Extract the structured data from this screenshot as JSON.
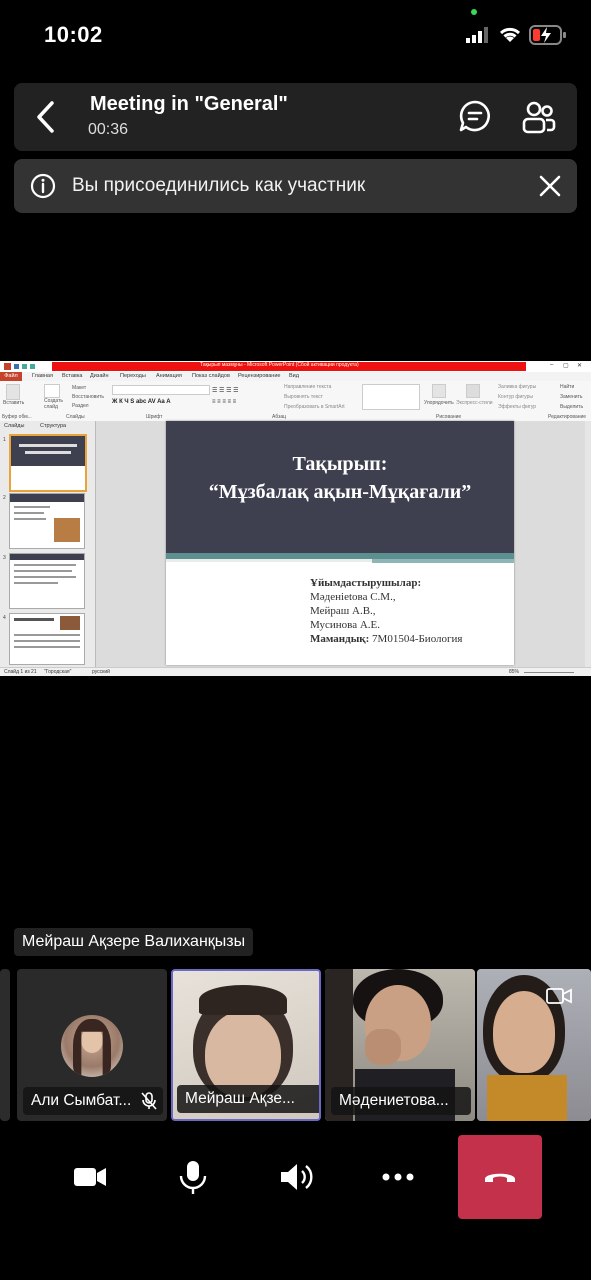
{
  "status_bar": {
    "time": "10:02"
  },
  "meeting": {
    "title": "Meeting in \"General\"",
    "duration": "00:36"
  },
  "banner": {
    "text": "Вы присоединились как участник"
  },
  "shared_screen": {
    "window_title": "Тақырып мазмұны - Microsoft PowerPoint (Сбой активации продукта)",
    "file_tab": "Файл",
    "menu_tabs": [
      "Главная",
      "Вставка",
      "Дизайн",
      "Переходы",
      "Анимация",
      "Показ слайдов",
      "Рецензирование",
      "Вид"
    ],
    "ribbon_groups": [
      "Буфер обм...",
      "Слайды",
      "Шрифт",
      "Абзац",
      "Рисование",
      "Редактирование"
    ],
    "ribbon_labels": {
      "paste": "Вставить",
      "create_slide": "Создать слайд",
      "layout": "Макет",
      "reset": "Восстановить",
      "section": "Раздел",
      "text_direction": "Направление текста",
      "align_text": "Выровнять текст",
      "smartart": "Преобразовать в SmartArt",
      "arrange": "Упорядочить",
      "quick_styles": "Экспресс-стили",
      "shape_fill": "Заливка фигуры",
      "shape_outline": "Контур фигуры",
      "shape_effects": "Эффекты фигур",
      "find": "Найти",
      "replace": "Заменить",
      "select": "Выделить"
    },
    "panel_tabs": [
      "Слайды",
      "Структура"
    ],
    "slide": {
      "title_line1": "Тақырып:",
      "title_line2": "“Мұзбалақ ақын-Мұқағали”",
      "organizers_label": "Ұйымдастырушылар:",
      "organizers": [
        "Мәденietова С.М.,",
        "Мейраш А.В.,",
        "Мусинова А.Е."
      ],
      "specialty_label": "Мамандық:",
      "specialty_value": "7М01504-Биология"
    },
    "status": {
      "slide_info": "Слайд 1 из 21",
      "theme": "\"Городская\"",
      "language": "русский",
      "zoom": "85%"
    }
  },
  "active_speaker": "Мейраш Ақзере Валиханқызы",
  "participants": [
    {
      "name": "Али Сымбат...",
      "muted": true
    },
    {
      "name": "Мейраш Ақзе...",
      "active": true
    },
    {
      "name": "Мәдениетова..."
    }
  ],
  "controls": {
    "icons": [
      "camera-icon",
      "microphone-icon",
      "speaker-icon",
      "more-icon",
      "hang-up-icon"
    ],
    "hangup_color": "#c4314b"
  }
}
